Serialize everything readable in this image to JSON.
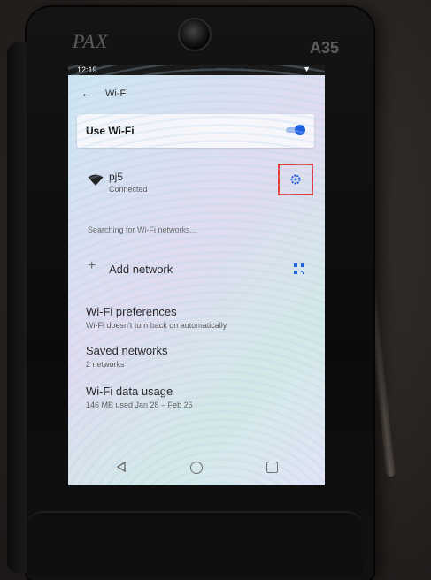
{
  "device": {
    "brand": "PAX",
    "model": "A35"
  },
  "status_bar": {
    "time": "12:19",
    "signal_icon": "signal-triangle-icon"
  },
  "app_bar": {
    "back_icon": "arrow-back-icon",
    "title": "Wi-Fi"
  },
  "use_wifi": {
    "label": "Use Wi-Fi",
    "enabled": true,
    "accent": "#1e5fe0"
  },
  "connected_network": {
    "name": "pj5",
    "status": "Connected",
    "icon": "wifi-icon",
    "settings_icon": "gear-icon",
    "highlight_color": "#e43a3a"
  },
  "searching_text": "Searching for Wi-Fi networks...",
  "add_network": {
    "label": "Add network",
    "icon": "plus-icon",
    "qr_icon": "qr-code-icon"
  },
  "preferences": [
    {
      "title": "Wi-Fi preferences",
      "subtitle": "Wi-Fi doesn't turn back on automatically"
    },
    {
      "title": "Saved networks",
      "subtitle": "2 networks"
    },
    {
      "title": "Wi-Fi data usage",
      "subtitle": "146 MB used Jan 28 – Feb 25"
    }
  ],
  "nav_bar": {
    "back": "nav-back-icon",
    "home": "nav-home-icon",
    "recent": "nav-recent-icon"
  }
}
